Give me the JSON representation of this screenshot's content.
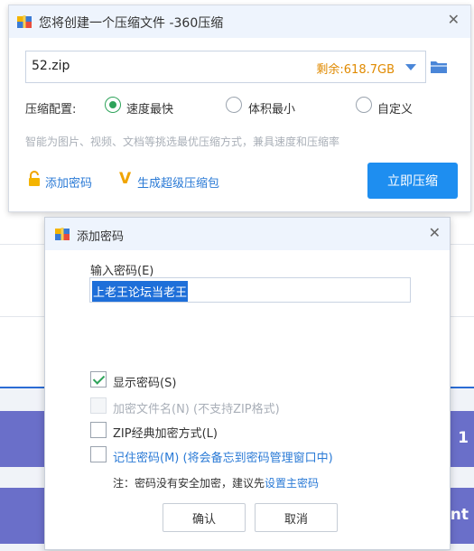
{
  "background": {
    "purple_text_1": "1",
    "purple_text_2": "Int"
  },
  "main_dialog": {
    "title": "您将创建一个压缩文件 -360压缩",
    "close_icon": "close-icon",
    "path_value": "52.zip",
    "free_space": "剩余:618.7GB",
    "config_label": "压缩配置:",
    "options": [
      "速度最快",
      "体积最小",
      "自定义"
    ],
    "selected_option": "速度最快",
    "hint": "智能为图片、视频、文档等挑选最优压缩方式，兼具速度和压缩率",
    "add_password_label": "添加密码",
    "super_package_label": "生成超级压缩包",
    "compress_button": "立即压缩"
  },
  "password_dialog": {
    "title": "添加密码",
    "input_label": "输入密码(E)",
    "password_value": "上老王论坛当老王",
    "checkboxes": [
      {
        "label": "显示密码(S)",
        "checked": true,
        "enabled": true
      },
      {
        "label": "加密文件名(N) (不支持ZIP格式)",
        "checked": false,
        "enabled": false
      },
      {
        "label": "ZIP经典加密方式(L)",
        "checked": false,
        "enabled": true
      },
      {
        "label": "记住密码(M) (将会备忘到密码管理窗口中)",
        "checked": false,
        "enabled": true
      }
    ],
    "note_text": "注：密码没有安全加密，建议先",
    "note_link": "设置主密码",
    "ok_button": "确认",
    "cancel_button": "取消"
  },
  "colors": {
    "accent": "#1e8ef0",
    "warning": "#e08a00",
    "link": "#2a7ad6",
    "check": "#2ea35a",
    "bg_purple": "#6a6fc9"
  }
}
